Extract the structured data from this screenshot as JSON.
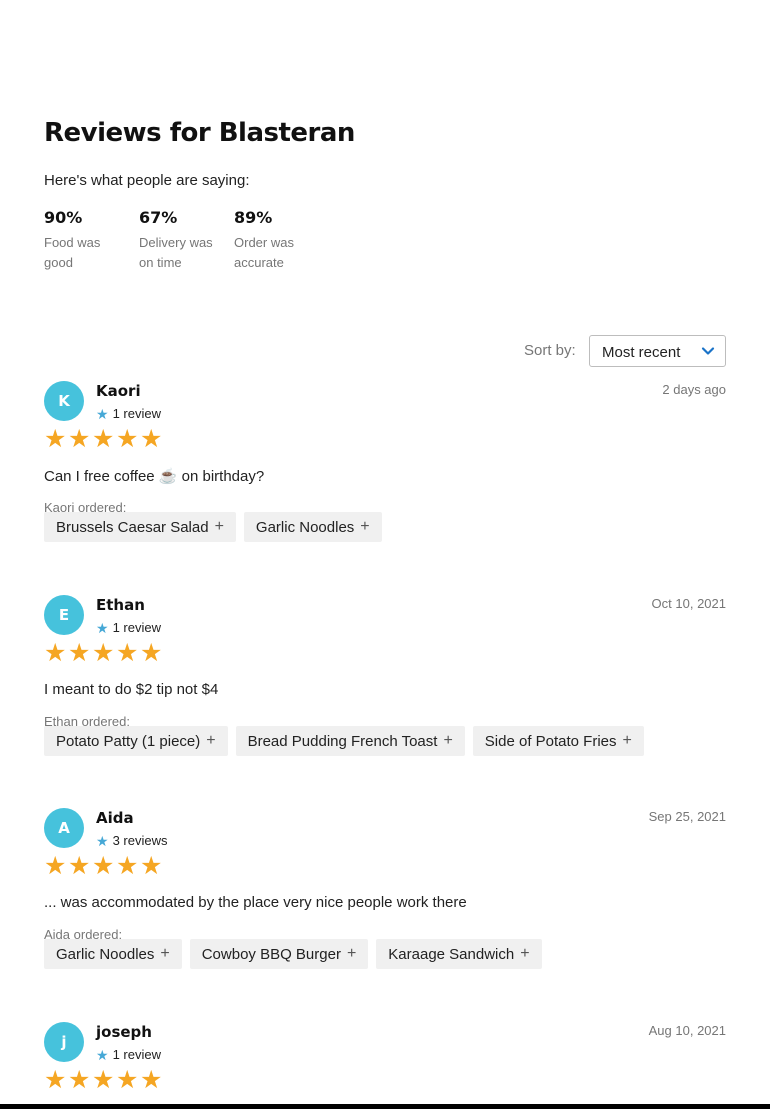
{
  "page": {
    "title": "Reviews for Blasteran",
    "subtitle": "Here's what people are saying:"
  },
  "stats": [
    {
      "percent": "90%",
      "label": "Food was good"
    },
    {
      "percent": "67%",
      "label": "Delivery was on time"
    },
    {
      "percent": "89%",
      "label": "Order was accurate"
    }
  ],
  "sort": {
    "label": "Sort by:",
    "selected": "Most recent",
    "icon": "chevron-down-icon"
  },
  "star_glyph": "★",
  "plus_glyph": "+",
  "colors": {
    "avatar": "#46c2dc",
    "star": "#f5a623",
    "review_count_star": "#46a8d6"
  },
  "reviews": [
    {
      "initial": "K",
      "name": "Kaori",
      "review_count": "1 review",
      "date": "2 days ago",
      "rating": 5,
      "text": "Can I free coffee ☕️ on birthday?",
      "ordered_label": "Kaori ordered:",
      "items": [
        "Brussels Caesar Salad",
        "Garlic Noodles"
      ]
    },
    {
      "initial": "E",
      "name": "Ethan",
      "review_count": "1 review",
      "date": "Oct 10, 2021",
      "rating": 5,
      "text": "I meant to do $2 tip not $4",
      "ordered_label": "Ethan ordered:",
      "items": [
        "Potato Patty (1 piece)",
        "Bread Pudding French Toast",
        "Side of Potato Fries"
      ]
    },
    {
      "initial": "A",
      "name": "Aida",
      "review_count": "3 reviews",
      "date": "Sep 25, 2021",
      "rating": 5,
      "text": "... was accommodated by the place very nice people work there",
      "ordered_label": "Aida ordered:",
      "items": [
        "Garlic Noodles",
        "Cowboy BBQ Burger",
        "Karaage Sandwich"
      ]
    },
    {
      "initial": "j",
      "name": "joseph",
      "review_count": "1 review",
      "date": "Aug 10, 2021",
      "rating": 5
    }
  ]
}
